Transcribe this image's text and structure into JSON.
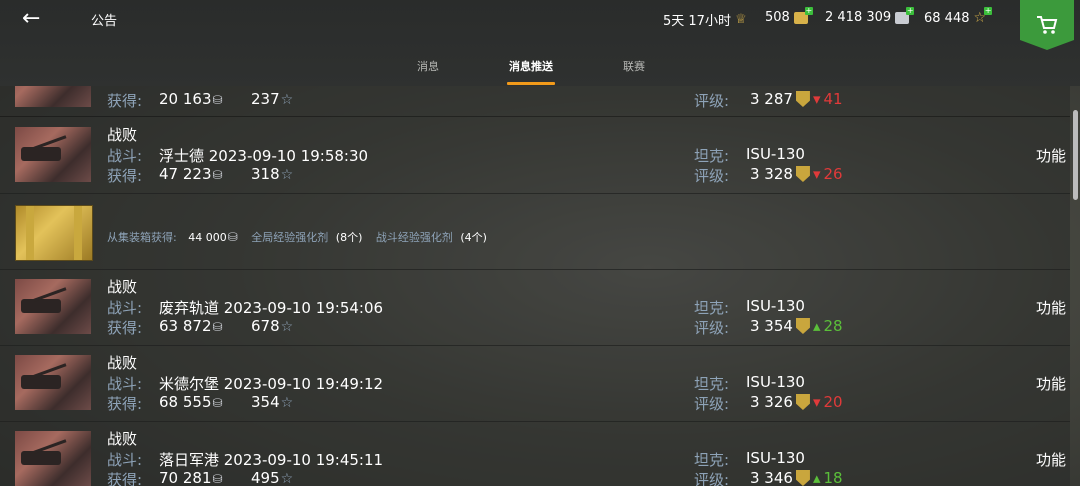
{
  "header": {
    "back_icon": "arrow-left-icon",
    "title": "公告",
    "premium_time": "5天 17小时",
    "gold": "508",
    "silver": "2 418 309",
    "free_xp": "68 448"
  },
  "tabs": [
    {
      "label": "消息",
      "active": false
    },
    {
      "label": "消息推送",
      "active": true
    },
    {
      "label": "联赛",
      "active": false
    }
  ],
  "labels": {
    "battle": "战斗:",
    "earned": "获得:",
    "tank": "坦克:",
    "rating": "评级:",
    "function": "功能"
  },
  "rows": [
    {
      "result": "",
      "earned_silver": "20 163",
      "earned_xp": "237",
      "rating": "3 287",
      "delta": "41",
      "trend": "down",
      "partial": true
    },
    {
      "result": "战败",
      "map": "浮士德 2023-09-10 19:58:30",
      "earned_silver": "47 223",
      "earned_xp": "318",
      "tank": "ISU-130",
      "rating": "3 328",
      "delta": "26",
      "trend": "down"
    },
    {
      "chest": true,
      "source": "从集装箱获得:",
      "silver": "44 000",
      "item1": "全局经验强化剂",
      "item1_count": "(8个)",
      "item2": "战斗经验强化剂",
      "item2_count": "(4个)"
    },
    {
      "result": "战败",
      "map": "废弃轨道 2023-09-10 19:54:06",
      "earned_silver": "63 872",
      "earned_xp": "678",
      "tank": "ISU-130",
      "rating": "3 354",
      "delta": "28",
      "trend": "up"
    },
    {
      "result": "战败",
      "map": "米德尔堡 2023-09-10 19:49:12",
      "earned_silver": "68 555",
      "earned_xp": "354",
      "tank": "ISU-130",
      "rating": "3 326",
      "delta": "20",
      "trend": "down"
    },
    {
      "result": "战败",
      "map": "落日军港 2023-09-10 19:45:11",
      "earned_silver": "70 281",
      "earned_xp": "495",
      "tank": "ISU-130",
      "rating": "3 346",
      "delta": "18",
      "trend": "up"
    }
  ],
  "colors": {
    "accent": "#f29a1a",
    "down": "#e03a3a",
    "up": "#5bbf3a",
    "shop": "#3c9a3c"
  }
}
